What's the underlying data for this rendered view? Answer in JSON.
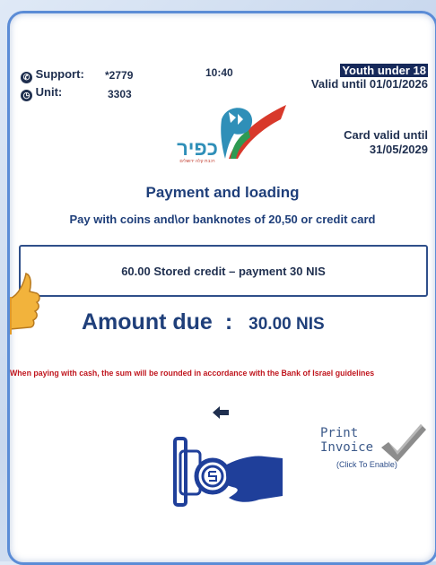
{
  "header": {
    "support_label": "Support:",
    "support_value": "*2779",
    "unit_label": "Unit:",
    "unit_value": "3303",
    "clock": "10:40",
    "profile_name": "Youth under 18",
    "profile_valid": "Valid until 01/01/2026",
    "card_valid_label": "Card valid until",
    "card_valid_date": "31/05/2029"
  },
  "logo": {
    "name": "כפיר",
    "tagline": "רכבת קלה ירושלים"
  },
  "main": {
    "title": "Payment and loading",
    "subtitle": "Pay with coins and\\or banknotes of 20,50 or credit card",
    "option": "60.00 Stored credit – payment 30 NIS",
    "amount_label": "Amount due",
    "amount_colon": ":",
    "amount_value": "30.00 NIS",
    "cash_notice": "When paying with cash, the sum will be rounded in accordance with the Bank of Israel guidelines"
  },
  "footer": {
    "print_line1": "Print",
    "print_line2": "Invoice",
    "print_hint": "(Click To Enable)"
  },
  "icons": {
    "phone": "phone-icon",
    "unit": "unit-icon",
    "back": "arrow-left-icon",
    "payment": "card-insert-icon",
    "print": "checkmark-icon",
    "pointer": "thumbs-up-hand-icon"
  },
  "colors": {
    "frame": "#5b8cd6",
    "text_primary": "#1f3f7a",
    "highlight_bg": "#16295a",
    "notice_red": "#c0161e",
    "logo_blue": "#2f8fb8",
    "logo_red": "#d8392b",
    "logo_green": "#2e9a52"
  }
}
